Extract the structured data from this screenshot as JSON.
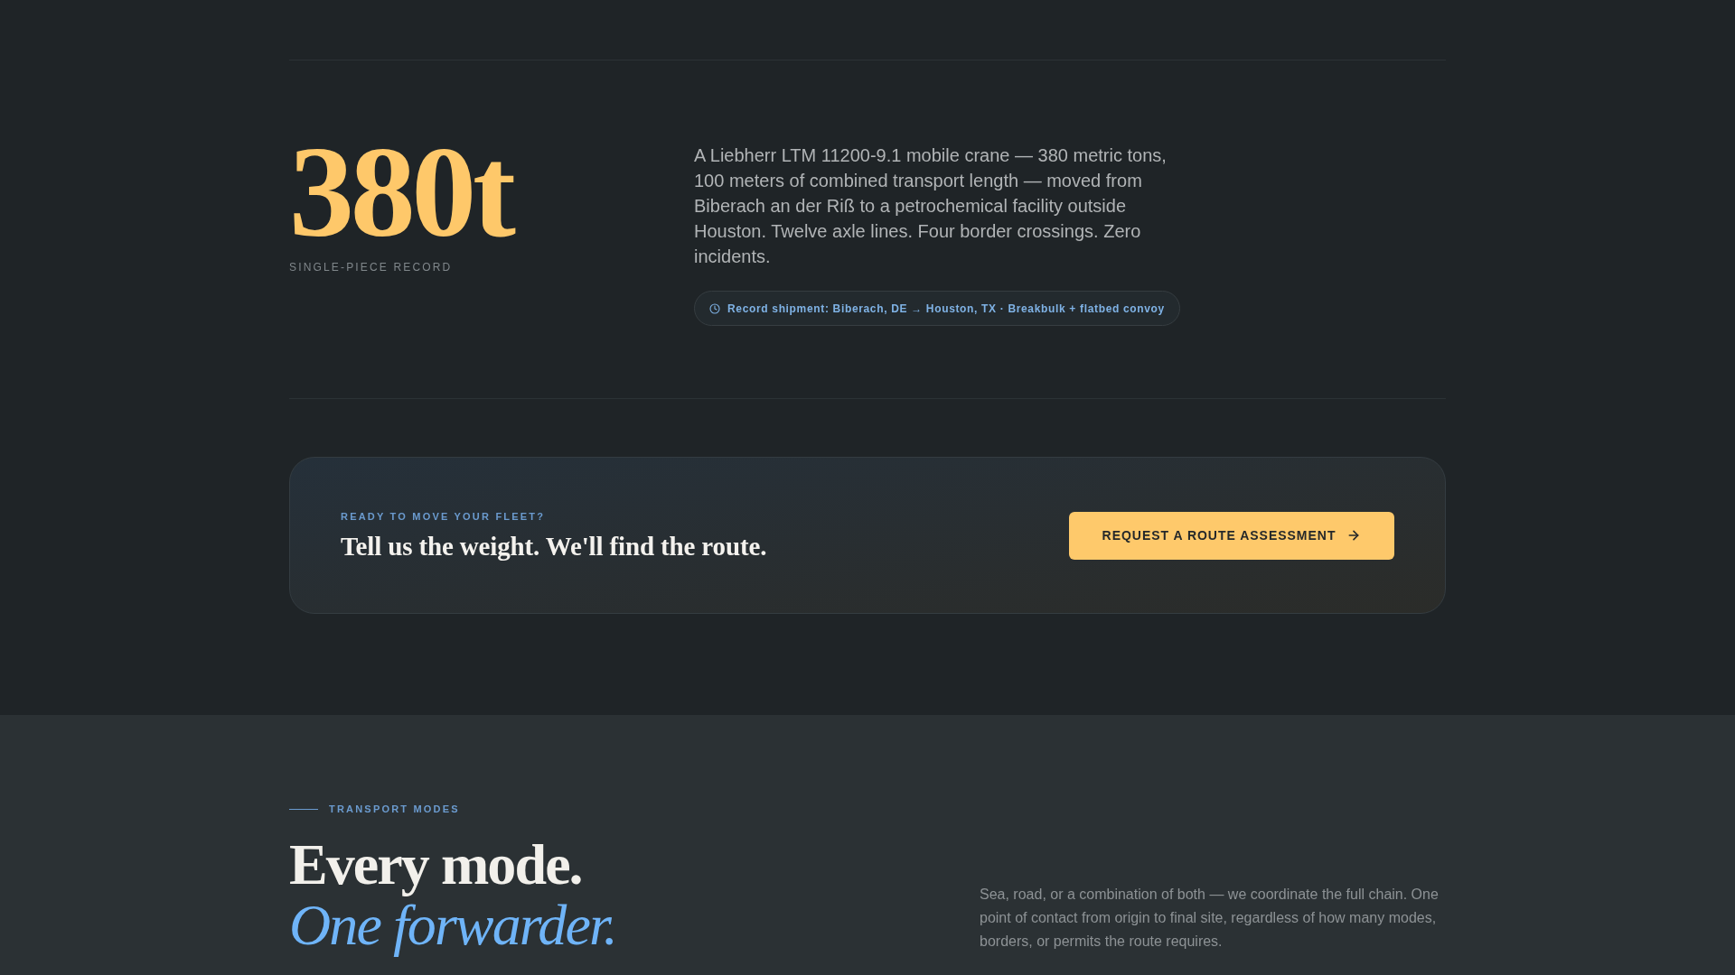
{
  "record": {
    "figure": "380t",
    "label": "SINGLE-PIECE RECORD",
    "description": "A Liebherr LTM 11200-9.1 mobile crane — 380 metric tons, 100 meters of combined transport length — moved from Biberach an der Riß to a petrochemical facility outside Houston. Twelve axle lines. Four border crossings. Zero incidents.",
    "shipment_tag": "Record shipment: Biberach, DE → Houston, TX · Breakbulk + flatbed convoy"
  },
  "cta": {
    "eyebrow": "READY TO MOVE YOUR FLEET?",
    "heading": "Tell us the weight. We'll find the route.",
    "button": "REQUEST A ROUTE ASSESSMENT"
  },
  "transport_modes": {
    "eyebrow": "TRANSPORT MODES",
    "heading": [
      {
        "text": "Every mode.",
        "kind": "plain"
      },
      {
        "text": "One forwarder.",
        "kind": "accent"
      }
    ],
    "description": "Sea, road, or a combination of both — we coordinate the full chain. One point of contact from origin to final site, regardless of how many modes, borders, or permits the route requires."
  }
}
